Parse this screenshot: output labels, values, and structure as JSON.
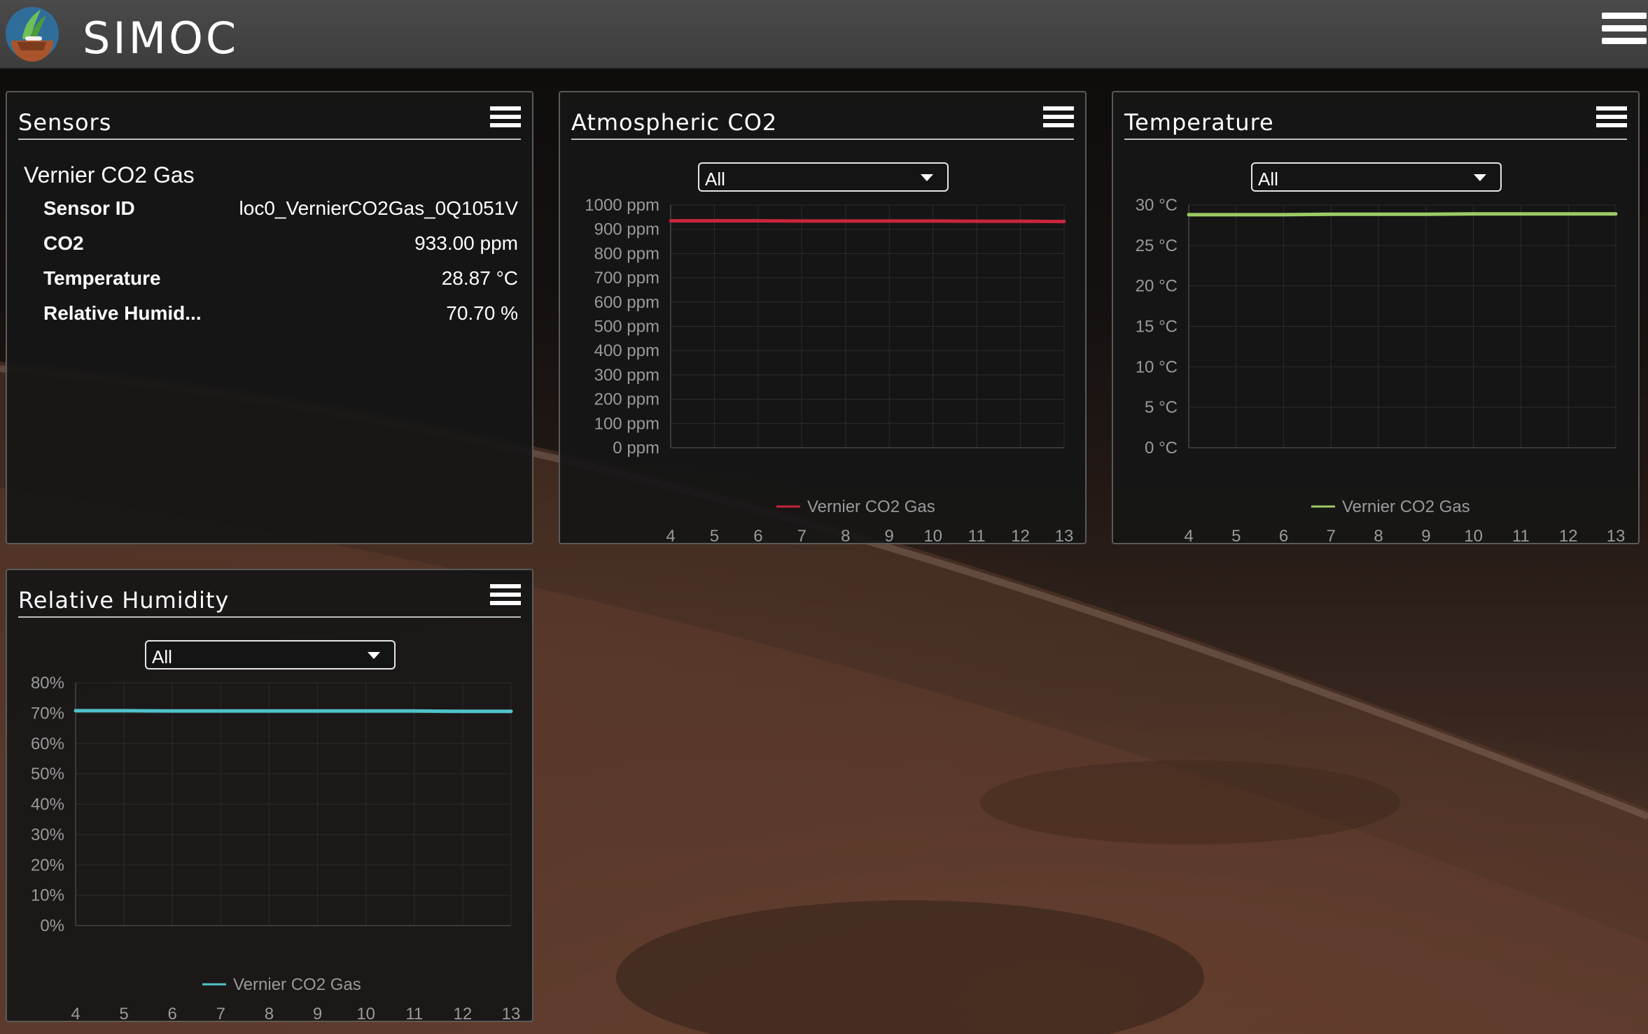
{
  "app": {
    "name": "SIMOC"
  },
  "panels": {
    "sensors": {
      "title": "Sensors",
      "sensor_name": "Vernier CO2 Gas",
      "rows": [
        {
          "label": "Sensor ID",
          "value": "loc0_VernierCO2Gas_0Q1051V"
        },
        {
          "label": "CO2",
          "value": "933.00 ppm"
        },
        {
          "label": "Temperature",
          "value": "28.87 °C"
        },
        {
          "label": "Relative Humid...",
          "value": "70.70 %"
        }
      ]
    },
    "co2": {
      "title": "Atmospheric CO2",
      "dropdown": "All"
    },
    "temperature": {
      "title": "Temperature",
      "dropdown": "All"
    },
    "humidity": {
      "title": "Relative Humidity",
      "dropdown": "All"
    }
  },
  "chart_data": [
    {
      "id": "co2",
      "type": "line",
      "x": [
        4,
        5,
        6,
        7,
        8,
        9,
        10,
        11,
        12,
        13
      ],
      "xticks": [
        "4",
        "5",
        "6",
        "7",
        "8",
        "9",
        "10",
        "11",
        "12",
        "13"
      ],
      "yticks": [
        "1000 ppm",
        "900 ppm",
        "800 ppm",
        "700 ppm",
        "600 ppm",
        "500 ppm",
        "400 ppm",
        "300 ppm",
        "200 ppm",
        "100 ppm",
        "0 ppm"
      ],
      "ylim": [
        0,
        1000
      ],
      "series": [
        {
          "name": "Vernier CO2 Gas",
          "color": "#c8263b",
          "values": [
            935,
            935,
            935,
            934,
            934,
            934,
            934,
            933,
            933,
            932
          ]
        }
      ],
      "legend": "bottom"
    },
    {
      "id": "temperature",
      "type": "line",
      "x": [
        4,
        5,
        6,
        7,
        8,
        9,
        10,
        11,
        12,
        13
      ],
      "xticks": [
        "4",
        "5",
        "6",
        "7",
        "8",
        "9",
        "10",
        "11",
        "12",
        "13"
      ],
      "yticks": [
        "30 °C",
        "25 °C",
        "20 °C",
        "15 °C",
        "10 °C",
        "5 °C",
        "0 °C"
      ],
      "ylim": [
        0,
        30
      ],
      "series": [
        {
          "name": "Vernier CO2 Gas",
          "color": "#9ccc65",
          "values": [
            28.8,
            28.8,
            28.8,
            28.85,
            28.85,
            28.85,
            28.9,
            28.9,
            28.9,
            28.9
          ]
        }
      ],
      "legend": "bottom"
    },
    {
      "id": "humidity",
      "type": "line",
      "x": [
        4,
        5,
        6,
        7,
        8,
        9,
        10,
        11,
        12,
        13
      ],
      "xticks": [
        "4",
        "5",
        "6",
        "7",
        "8",
        "9",
        "10",
        "11",
        "12",
        "13"
      ],
      "yticks": [
        "80%",
        "70%",
        "60%",
        "50%",
        "40%",
        "30%",
        "20%",
        "10%",
        "0%"
      ],
      "ylim": [
        0,
        80
      ],
      "series": [
        {
          "name": "Vernier CO2 Gas",
          "color": "#4fc3c9",
          "values": [
            70.8,
            70.8,
            70.7,
            70.7,
            70.7,
            70.7,
            70.7,
            70.7,
            70.6,
            70.6
          ]
        }
      ],
      "legend": "bottom"
    }
  ]
}
